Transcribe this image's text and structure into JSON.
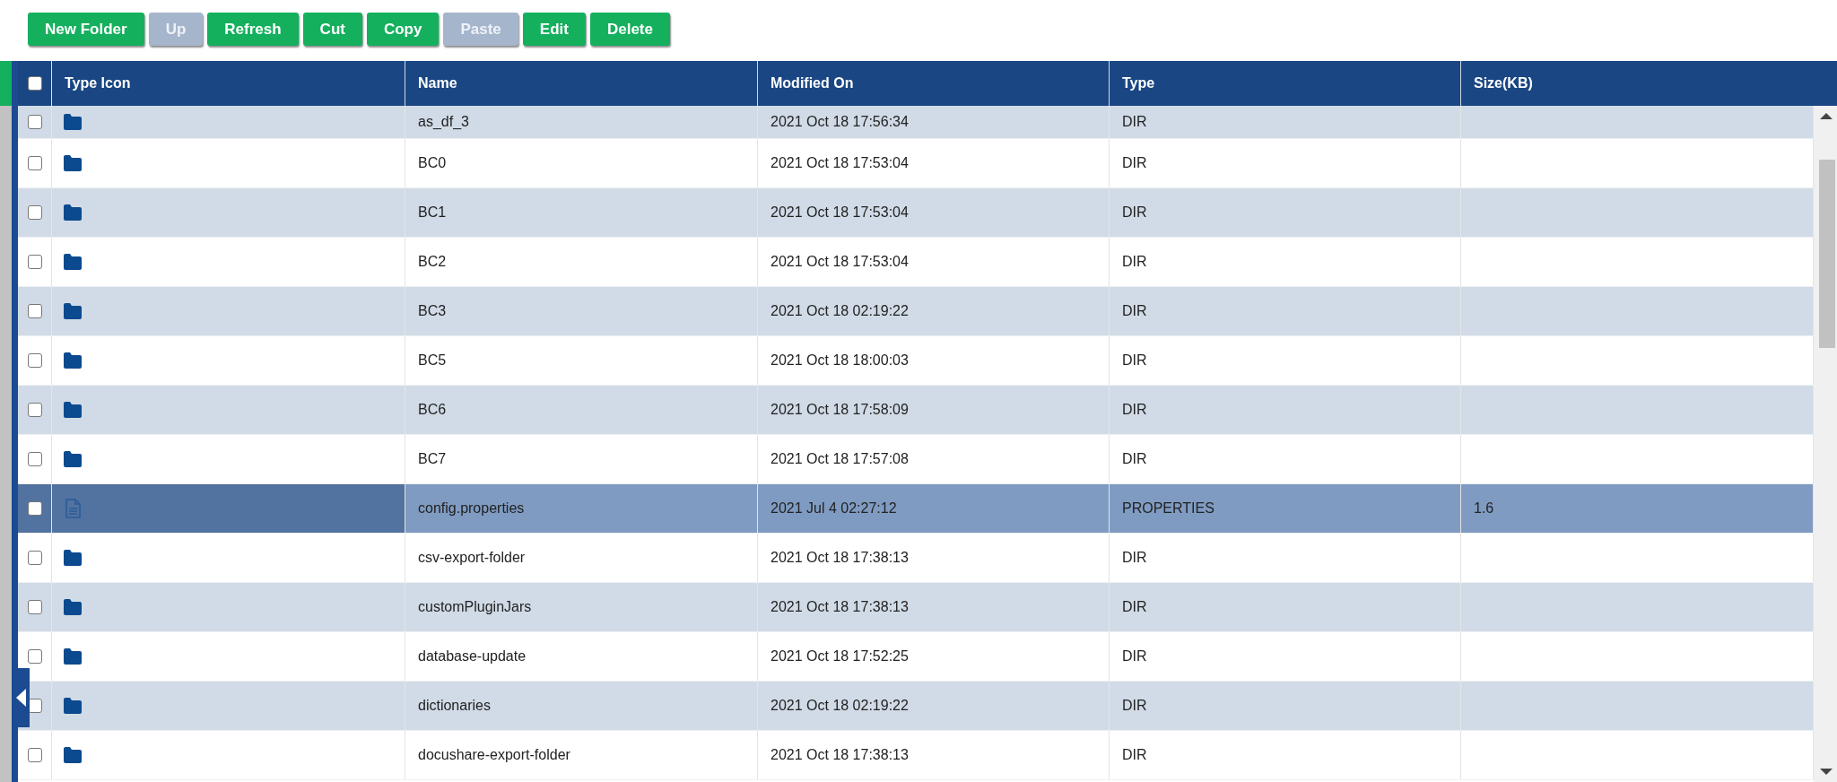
{
  "toolbar": [
    {
      "label": "New Folder",
      "disabled": false
    },
    {
      "label": "Up",
      "disabled": true
    },
    {
      "label": "Refresh",
      "disabled": false
    },
    {
      "label": "Cut",
      "disabled": false
    },
    {
      "label": "Copy",
      "disabled": false
    },
    {
      "label": "Paste",
      "disabled": true
    },
    {
      "label": "Edit",
      "disabled": false
    },
    {
      "label": "Delete",
      "disabled": false
    }
  ],
  "table": {
    "select_all": {
      "checked": false
    },
    "columns": [
      "Type Icon",
      "Name",
      "Modified On",
      "Type",
      "Size(KB)"
    ],
    "rows": [
      {
        "kind": "folder",
        "name": "as_df_3",
        "modified": "2021 Oct 18 17:56:34",
        "type": "DIR",
        "checked": false,
        "selected": false
      },
      {
        "kind": "folder",
        "name": "BC0",
        "modified": "2021 Oct 18 17:53:04",
        "type": "DIR",
        "checked": false,
        "selected": false
      },
      {
        "kind": "folder",
        "name": "BC1",
        "modified": "2021 Oct 18 17:53:04",
        "type": "DIR",
        "checked": false,
        "selected": false
      },
      {
        "kind": "folder",
        "name": "BC2",
        "modified": "2021 Oct 18 17:53:04",
        "type": "DIR",
        "checked": false,
        "selected": false
      },
      {
        "kind": "folder",
        "name": "BC3",
        "modified": "2021 Oct 18 02:19:22",
        "type": "DIR",
        "checked": false,
        "selected": false
      },
      {
        "kind": "folder",
        "name": "BC5",
        "modified": "2021 Oct 18 18:00:03",
        "type": "DIR",
        "checked": false,
        "selected": false
      },
      {
        "kind": "folder",
        "name": "BC6",
        "modified": "2021 Oct 18 17:58:09",
        "type": "DIR",
        "checked": false,
        "selected": false
      },
      {
        "kind": "folder",
        "name": "BC7",
        "modified": "2021 Oct 18 17:57:08",
        "type": "DIR",
        "checked": false,
        "selected": false
      },
      {
        "kind": "file",
        "name": "config.properties",
        "modified": "2021 Jul 4 02:27:12",
        "type": "PROPERTIES",
        "size": "1.6",
        "checked": false,
        "selected": true
      },
      {
        "kind": "folder",
        "name": "csv-export-folder",
        "modified": "2021 Oct 18 17:38:13",
        "type": "DIR",
        "checked": false,
        "selected": false
      },
      {
        "kind": "folder",
        "name": "customPluginJars",
        "modified": "2021 Oct 18 17:38:13",
        "type": "DIR",
        "checked": false,
        "selected": false
      },
      {
        "kind": "folder",
        "name": "database-update",
        "modified": "2021 Oct 18 17:52:25",
        "type": "DIR",
        "checked": false,
        "selected": false
      },
      {
        "kind": "folder",
        "name": "dictionaries",
        "modified": "2021 Oct 18 02:19:22",
        "type": "DIR",
        "checked": false,
        "selected": false
      },
      {
        "kind": "folder",
        "name": "docushare-export-folder",
        "modified": "2021 Oct 18 17:38:13",
        "type": "DIR",
        "checked": false,
        "selected": false
      }
    ]
  }
}
